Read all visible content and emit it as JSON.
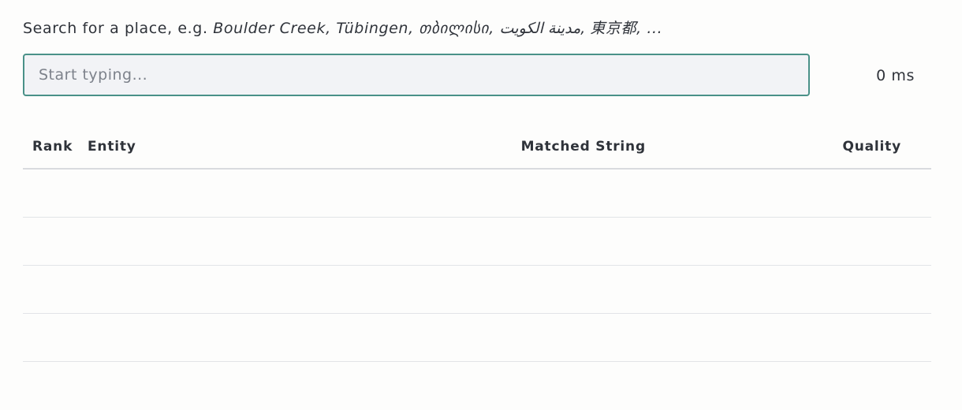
{
  "search": {
    "intro_prefix": "Search for a place, e.g. ",
    "intro_examples": "Boulder Creek, Tübingen, თბილისი, مدينة الكويت, 東京都, ...",
    "placeholder": "Start typing...",
    "value": ""
  },
  "timing": "0 ms",
  "table": {
    "columns": {
      "rank": "Rank",
      "entity": "Entity",
      "matched": "Matched String",
      "quality": "Quality"
    },
    "rows": [
      {
        "rank": "",
        "entity": "",
        "matched": "",
        "quality": ""
      },
      {
        "rank": "",
        "entity": "",
        "matched": "",
        "quality": ""
      },
      {
        "rank": "",
        "entity": "",
        "matched": "",
        "quality": ""
      },
      {
        "rank": "",
        "entity": "",
        "matched": "",
        "quality": ""
      }
    ]
  }
}
